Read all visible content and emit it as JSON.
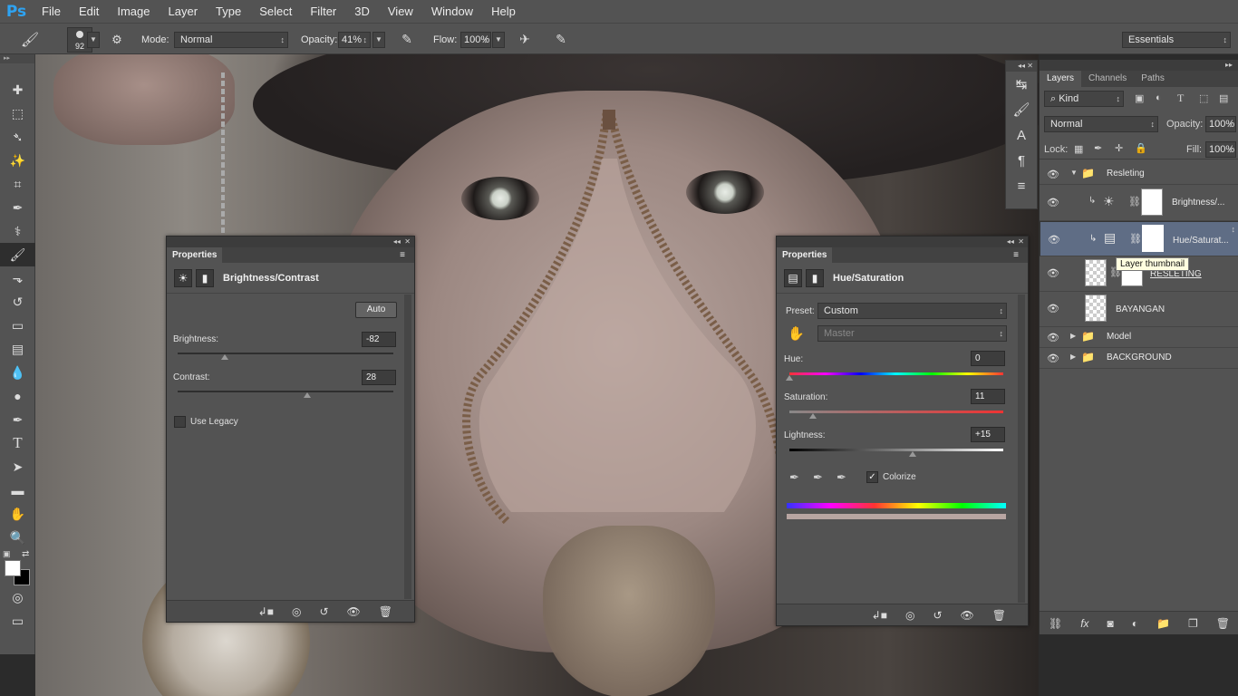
{
  "app": {
    "logo": "Ps"
  },
  "menu": [
    "File",
    "Edit",
    "Image",
    "Layer",
    "Type",
    "Select",
    "Filter",
    "3D",
    "View",
    "Window",
    "Help"
  ],
  "options": {
    "brush_size": "92",
    "mode_label": "Mode:",
    "mode_value": "Normal",
    "opacity_label": "Opacity:",
    "opacity_value": "41%",
    "flow_label": "Flow:",
    "flow_value": "100%",
    "workspace": "Essentials"
  },
  "tools": [
    "move-tool",
    "marquee-tool",
    "lasso-tool",
    "magic-wand-tool",
    "crop-tool",
    "eyedropper-tool",
    "healing-tool",
    "brush-tool",
    "stamp-tool",
    "history-brush-tool",
    "eraser-tool",
    "gradient-tool",
    "blur-tool",
    "dodge-tool",
    "pen-tool",
    "type-tool",
    "path-selection-tool",
    "shape-tool",
    "hand-tool",
    "zoom-tool"
  ],
  "layers_panel": {
    "tabs": [
      "Layers",
      "Channels",
      "Paths"
    ],
    "kind_label": "Kind",
    "blend_mode": "Normal",
    "opacity_label": "Opacity:",
    "opacity_value": "100%",
    "lock_label": "Lock:",
    "fill_label": "Fill:",
    "fill_value": "100%",
    "layers": [
      {
        "name": "Resleting",
        "type": "group"
      },
      {
        "name": "Brightness/...",
        "type": "adjustment"
      },
      {
        "name": "Hue/Saturat...",
        "type": "adjustment",
        "selected": true
      },
      {
        "name": "RESLETING",
        "type": "pixel"
      },
      {
        "name": "BAYANGAN",
        "type": "pixel"
      },
      {
        "name": "Model",
        "type": "group"
      },
      {
        "name": "BACKGROUND",
        "type": "group"
      }
    ],
    "tooltip": "Layer thumbnail"
  },
  "brightness_panel": {
    "tab": "Properties",
    "title": "Brightness/Contrast",
    "auto_label": "Auto",
    "brightness_label": "Brightness:",
    "brightness_value": "-82",
    "contrast_label": "Contrast:",
    "contrast_value": "28",
    "legacy_label": "Use Legacy",
    "legacy_checked": false,
    "brightness_fraction": 0.22,
    "contrast_fraction": 0.6
  },
  "hue_panel": {
    "tab": "Properties",
    "title": "Hue/Saturation",
    "preset_label": "Preset:",
    "preset_value": "Custom",
    "channel_value": "Master",
    "hue_label": "Hue:",
    "hue_value": "0",
    "saturation_label": "Saturation:",
    "saturation_value": "11",
    "lightness_label": "Lightness:",
    "lightness_value": "+15",
    "colorize_label": "Colorize",
    "colorize_checked": true,
    "hue_fraction": 0.0,
    "saturation_fraction": 0.11,
    "lightness_fraction": 0.575
  },
  "colors": {
    "accent": "#2ea3f2",
    "panel": "#535353",
    "selection": "#5f6d85"
  }
}
